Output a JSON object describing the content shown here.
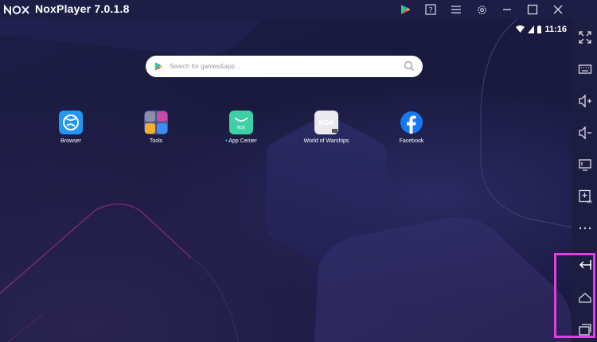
{
  "window": {
    "title": "NoxPlayer 7.0.1.8",
    "logo_text": "nox",
    "controls": [
      "play-store-icon",
      "help-icon",
      "menu-icon",
      "settings-icon",
      "minimize-icon",
      "maximize-icon",
      "close-icon"
    ]
  },
  "statusbar": {
    "time": "11:16"
  },
  "search": {
    "placeholder": "Search for games&app..."
  },
  "apps": [
    {
      "label": "Browser",
      "icon": "browser-icon"
    },
    {
      "label": "Tools",
      "icon": "tools-folder-icon"
    },
    {
      "label": "App Center",
      "icon": "app-center-icon"
    },
    {
      "label": "World of Warships",
      "icon": "world-of-warships-icon"
    },
    {
      "label": "Facebook",
      "icon": "facebook-icon"
    }
  ],
  "sidebar": {
    "items": [
      "fullscreen-icon",
      "keyboard-icon",
      "volume-up-icon",
      "volume-down-icon",
      "screen-icon",
      "apk-install-icon",
      "more-icon",
      "back-icon",
      "home-icon",
      "recents-icon"
    ]
  },
  "colors": {
    "background": "#1b1c3d",
    "titlebar": "#1d1e46",
    "highlight": "#e33fe0",
    "play_green": "#2bd27b",
    "facebook_blue": "#1877f2"
  }
}
